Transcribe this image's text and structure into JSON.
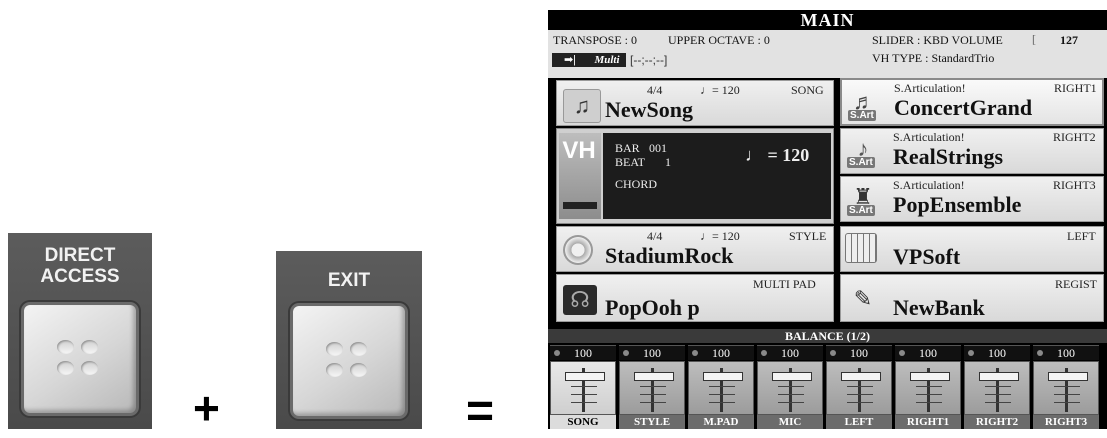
{
  "hardware": {
    "direct_access_label_1": "DIRECT",
    "direct_access_label_2": "ACCESS",
    "exit_label": "EXIT",
    "plus": "+",
    "equals": "="
  },
  "screen": {
    "title": "MAIN",
    "info": {
      "transpose": "TRANSPOSE : 0",
      "upper_octave": "UPPER OCTAVE : 0",
      "slider": "SLIDER : KBD VOLUME",
      "slider_value": "127",
      "multi": "Multi",
      "multi_arrow": "➡|",
      "fingering": "[--;--;--]",
      "vh_type": "VH TYPE : StandardTrio"
    },
    "song": {
      "meter": "4/4",
      "tempo": "♩= 120",
      "tag": "SONG",
      "name": "NewSong"
    },
    "song_position": {
      "bar_label": "BAR",
      "bar_value": "001",
      "beat_label": "BEAT",
      "beat_value": "1",
      "tempo": "♩ = 120",
      "chord_label": "CHORD"
    },
    "vh_logo": "VH",
    "style": {
      "meter": "4/4",
      "tempo": "♩= 120",
      "tag": "STYLE",
      "name": "StadiumRock"
    },
    "multipad": {
      "tag": "MULTI PAD",
      "name": "PopOoh p"
    },
    "voices": [
      {
        "articulation": "S.Articulation!",
        "part": "RIGHT1",
        "name": "ConcertGrand",
        "badge": "S.Art"
      },
      {
        "articulation": "S.Articulation!",
        "part": "RIGHT2",
        "name": "RealStrings",
        "badge": "S.Art"
      },
      {
        "articulation": "S.Articulation!",
        "part": "RIGHT3",
        "name": "PopEnsemble",
        "badge": "S.Art"
      },
      {
        "articulation": "",
        "part": "LEFT",
        "name": "VPSoft",
        "badge": ""
      },
      {
        "articulation": "",
        "part": "REGIST",
        "name": "NewBank",
        "badge": ""
      }
    ],
    "balance": {
      "title": "BALANCE (1/2)",
      "channels": [
        {
          "label": "SONG",
          "value": "100"
        },
        {
          "label": "STYLE",
          "value": "100"
        },
        {
          "label": "M.PAD",
          "value": "100"
        },
        {
          "label": "MIC",
          "value": "100"
        },
        {
          "label": "LEFT",
          "value": "100"
        },
        {
          "label": "RIGHT1",
          "value": "100"
        },
        {
          "label": "RIGHT2",
          "value": "100"
        },
        {
          "label": "RIGHT3",
          "value": "100"
        }
      ]
    }
  }
}
